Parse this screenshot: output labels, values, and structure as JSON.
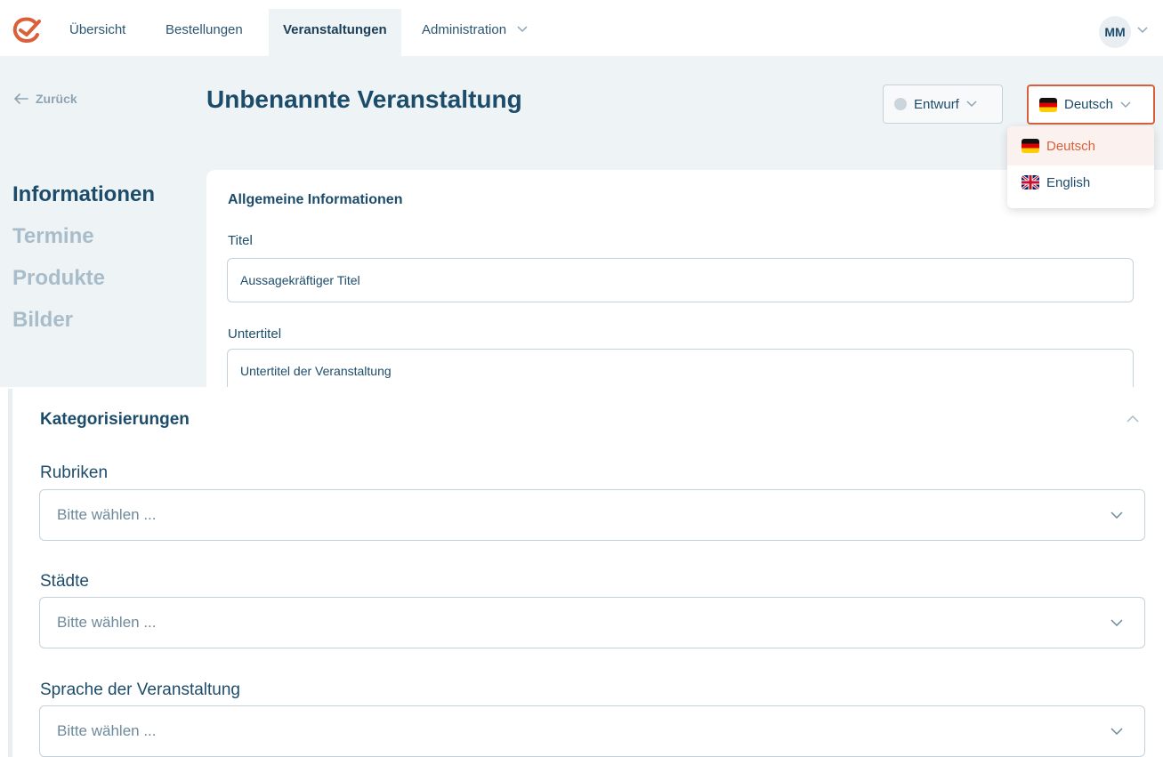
{
  "nav": {
    "items": [
      "Übersicht",
      "Bestellungen",
      "Veranstaltungen",
      "Administration"
    ],
    "active": "Veranstaltungen",
    "user_initials": "MM"
  },
  "header": {
    "back_label": "Zurück",
    "title": "Unbenannte Veranstaltung",
    "status_label": "Entwurf",
    "language_label": "Deutsch"
  },
  "language_menu": {
    "options": [
      "Deutsch",
      "English"
    ],
    "selected": "Deutsch"
  },
  "side_nav": {
    "items": [
      "Informationen",
      "Termine",
      "Produkte",
      "Bilder"
    ],
    "active": "Informationen"
  },
  "general_info": {
    "heading": "Allgemeine Informationen",
    "title_label": "Titel",
    "title_value": "Aussagekräftiger Titel",
    "subtitle_label": "Untertitel",
    "subtitle_value": "Untertitel der Veranstaltung"
  },
  "categorization": {
    "heading": "Kategorisierungen",
    "fields": [
      {
        "label": "Rubriken",
        "placeholder": "Bitte wählen ..."
      },
      {
        "label": "Städte",
        "placeholder": "Bitte wählen ..."
      },
      {
        "label": "Sprache der Veranstaltung",
        "placeholder": "Bitte wählen ..."
      }
    ]
  },
  "colors": {
    "brand": "#d9603b",
    "text_primary": "#1d4c6b",
    "muted_nav": "#a8bcca",
    "background": "#eef3f5",
    "border": "#c5d2da"
  },
  "icons": {
    "logo": "brand-logo-icon",
    "back": "arrow-left-icon",
    "chevron": "chevron-down-icon",
    "collapse": "chevron-up-icon",
    "flag_de": "flag-de-icon",
    "flag_en": "flag-uk-icon"
  }
}
